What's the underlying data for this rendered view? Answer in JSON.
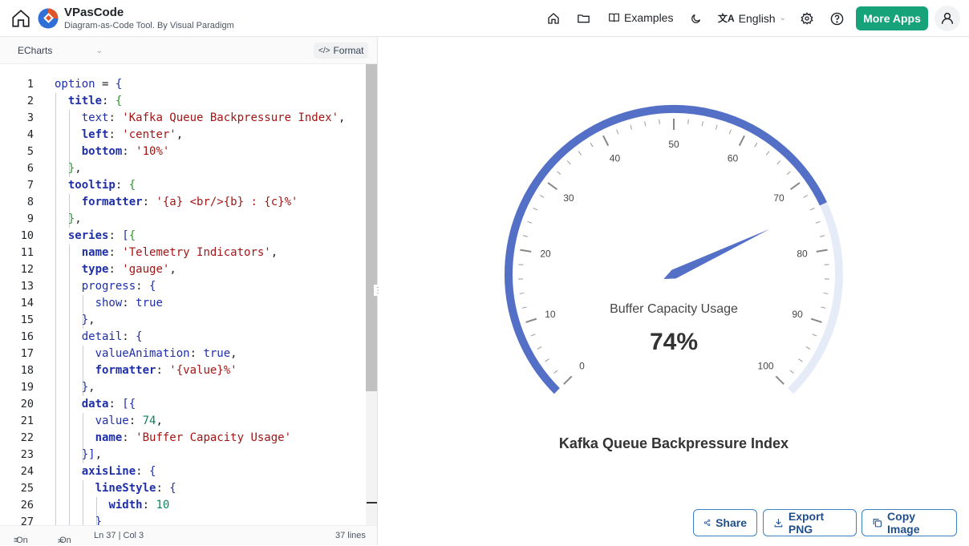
{
  "header": {
    "app_name": "VPasCode",
    "app_subtitle": "Diagram-as-Code Tool. By Visual Paradigm",
    "examples_label": "Examples",
    "language_label": "English",
    "more_apps_label": "More Apps"
  },
  "editor": {
    "language": "ECharts",
    "format_label": "Format",
    "status": {
      "wrap": "On",
      "minimap": "On",
      "cursor": "Ln 37 | Col 3",
      "lines": "37 lines"
    },
    "line_numbers": [
      "1",
      "2",
      "3",
      "4",
      "5",
      "6",
      "7",
      "8",
      "9",
      "10",
      "11",
      "12",
      "13",
      "14",
      "15",
      "16",
      "17",
      "18",
      "19",
      "20",
      "21",
      "22",
      "23",
      "24",
      "25",
      "26",
      "27"
    ],
    "code_lines": [
      "option = {",
      "  title: {",
      "    text: 'Kafka Queue Backpressure Index',",
      "    left: 'center',",
      "    bottom: '10%'",
      "  },",
      "  tooltip: {",
      "    formatter: '{a} <br/>{b} : {c}%'",
      "  },",
      "  series: [{",
      "    name: 'Telemetry Indicators',",
      "    type: 'gauge',",
      "    progress: {",
      "      show: true",
      "    },",
      "    detail: {",
      "      valueAnimation: true,",
      "      formatter: '{value}%'",
      "    },",
      "    data: [{",
      "      value: 74,",
      "      name: 'Buffer Capacity Usage'",
      "    }],",
      "    axisLine: {",
      "      lineStyle: {",
      "        width: 10",
      "      }"
    ]
  },
  "preview": {
    "share_label": "Share",
    "export_label": "Export PNG",
    "copy_label": "Copy Image"
  },
  "chart_data": {
    "type": "gauge",
    "title": "Kafka Queue Backpressure Index",
    "series_name": "Telemetry Indicators",
    "data_name": "Buffer Capacity Usage",
    "value": 74,
    "detail_text": "74%",
    "min": 0,
    "max": 100,
    "axis_labels": [
      "0",
      "10",
      "20",
      "30",
      "40",
      "50",
      "60",
      "70",
      "80",
      "90",
      "100"
    ],
    "progress_color": "#5470c6",
    "track_color": "#e6ebf8"
  }
}
